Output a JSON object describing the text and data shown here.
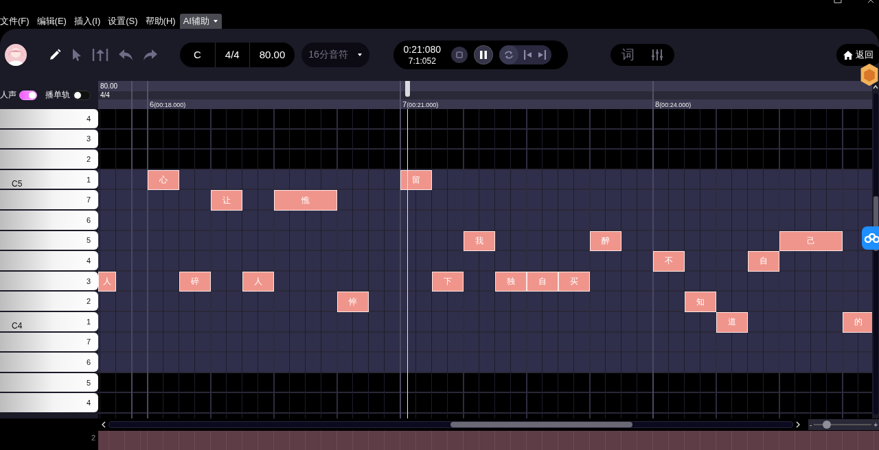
{
  "menu": [
    {
      "label": "文件(F)",
      "selected": false,
      "has_menu": false
    },
    {
      "label": "编辑(E)",
      "selected": false,
      "has_menu": false
    },
    {
      "label": "插入(I)",
      "selected": false,
      "has_menu": false
    },
    {
      "label": "设置(S)",
      "selected": false,
      "has_menu": false
    },
    {
      "label": "帮助(H)",
      "selected": false,
      "has_menu": false
    },
    {
      "label": "AI辅助",
      "selected": true,
      "has_menu": true
    }
  ],
  "toolbar": {
    "tools": [
      {
        "kind": "pencil",
        "selected": true
      },
      {
        "kind": "select",
        "selected": false
      },
      {
        "kind": "split",
        "selected": false
      },
      {
        "kind": "undo",
        "selected": false
      },
      {
        "kind": "redo",
        "selected": false
      }
    ],
    "song": {
      "key": "C",
      "time_signature": "4/4",
      "tempo": "80.00"
    },
    "snap": {
      "value": "16分音符"
    },
    "transport": {
      "time": "0:21:080",
      "position": "7:1:052",
      "playing": true,
      "loop": true
    },
    "panels": [
      {
        "kind": "lyrics",
        "label": "词"
      },
      {
        "kind": "mixer"
      }
    ],
    "home": {
      "label": "返回"
    }
  },
  "track_header": {
    "toggles": [
      {
        "label": "人声",
        "on": true
      },
      {
        "label": "播单轨",
        "on": false
      }
    ]
  },
  "ruler": {
    "tempo": "80.00",
    "time_signature": "4/4",
    "measures": [
      {
        "number": "6",
        "time": "(00:18.000)"
      },
      {
        "number": "7",
        "time": "(00:21.000)"
      },
      {
        "number": "8",
        "time": "(00:24.000)"
      }
    ]
  },
  "piano_keys": [
    {
      "label": "4"
    },
    {
      "label": "3"
    },
    {
      "label": "2"
    },
    {
      "label": "1",
      "octave_label": "C5",
      "slots": [
        {
          "kind": "rest"
        },
        {
          "kind": "rest"
        },
        {
          "kind": "note",
          "lyric": "心"
        },
        {
          "kind": "rest"
        },
        {
          "kind": "rest"
        },
        {
          "kind": "rest"
        },
        {
          "kind": "rest"
        },
        {
          "kind": "rest"
        },
        {
          "kind": "rest"
        },
        {
          "kind": "rest"
        },
        {
          "kind": "note",
          "lyric": "留"
        }
      ]
    },
    {
      "label": "7",
      "slots": [
        {
          "kind": "rest"
        },
        {
          "kind": "rest"
        },
        {
          "kind": "rest"
        },
        {
          "kind": "rest"
        },
        {
          "kind": "note",
          "lyric": "让"
        },
        {
          "kind": "rest"
        },
        {
          "kind": "note",
          "lyric": "憔"
        },
        {
          "kind": "hold"
        }
      ]
    },
    {
      "label": "6"
    },
    {
      "label": "5",
      "slots": [
        {
          "kind": "rest"
        },
        {
          "kind": "rest"
        },
        {
          "kind": "rest"
        },
        {
          "kind": "rest"
        },
        {
          "kind": "rest"
        },
        {
          "kind": "rest"
        },
        {
          "kind": "rest"
        },
        {
          "kind": "rest"
        },
        {
          "kind": "rest"
        },
        {
          "kind": "rest"
        },
        {
          "kind": "rest"
        },
        {
          "kind": "rest"
        },
        {
          "kind": "note",
          "lyric": "我"
        },
        {
          "kind": "rest"
        },
        {
          "kind": "rest"
        },
        {
          "kind": "rest"
        },
        {
          "kind": "note",
          "lyric": "醉"
        },
        {
          "kind": "rest"
        },
        {
          "kind": "rest"
        },
        {
          "kind": "rest"
        },
        {
          "kind": "rest"
        },
        {
          "kind": "rest"
        },
        {
          "kind": "note",
          "lyric": "己"
        },
        {
          "kind": "hold"
        }
      ]
    },
    {
      "label": "4",
      "slots": [
        {
          "kind": "rest"
        },
        {
          "kind": "rest"
        },
        {
          "kind": "rest"
        },
        {
          "kind": "rest"
        },
        {
          "kind": "rest"
        },
        {
          "kind": "rest"
        },
        {
          "kind": "rest"
        },
        {
          "kind": "rest"
        },
        {
          "kind": "rest"
        },
        {
          "kind": "rest"
        },
        {
          "kind": "rest"
        },
        {
          "kind": "rest"
        },
        {
          "kind": "rest"
        },
        {
          "kind": "rest"
        },
        {
          "kind": "rest"
        },
        {
          "kind": "rest"
        },
        {
          "kind": "rest"
        },
        {
          "kind": "rest"
        },
        {
          "kind": "note",
          "lyric": "不"
        },
        {
          "kind": "rest"
        },
        {
          "kind": "rest"
        },
        {
          "kind": "note",
          "lyric": "自"
        }
      ]
    },
    {
      "label": "3",
      "slots": [
        {
          "kind": "note",
          "lyric": "人"
        },
        {
          "kind": "rest"
        },
        {
          "kind": "rest"
        },
        {
          "kind": "note",
          "lyric": "碎"
        },
        {
          "kind": "rest"
        },
        {
          "kind": "note",
          "lyric": "人"
        },
        {
          "kind": "rest"
        },
        {
          "kind": "rest"
        },
        {
          "kind": "rest"
        },
        {
          "kind": "rest"
        },
        {
          "kind": "rest"
        },
        {
          "kind": "note",
          "lyric": "下"
        },
        {
          "kind": "rest"
        },
        {
          "kind": "note",
          "lyric": "独"
        },
        {
          "kind": "note",
          "lyric": "自"
        },
        {
          "kind": "note",
          "lyric": "买"
        }
      ]
    },
    {
      "label": "2",
      "slots": [
        {
          "kind": "rest"
        },
        {
          "kind": "rest"
        },
        {
          "kind": "rest"
        },
        {
          "kind": "rest"
        },
        {
          "kind": "rest"
        },
        {
          "kind": "rest"
        },
        {
          "kind": "rest"
        },
        {
          "kind": "rest"
        },
        {
          "kind": "note",
          "lyric": "悴"
        },
        {
          "kind": "rest"
        },
        {
          "kind": "rest"
        },
        {
          "kind": "rest"
        },
        {
          "kind": "rest"
        },
        {
          "kind": "rest"
        },
        {
          "kind": "rest"
        },
        {
          "kind": "rest"
        },
        {
          "kind": "rest"
        },
        {
          "kind": "rest"
        },
        {
          "kind": "rest"
        },
        {
          "kind": "note",
          "lyric": "知"
        }
      ]
    },
    {
      "label": "1",
      "octave_label": "C4",
      "slots": [
        {
          "kind": "rest"
        },
        {
          "kind": "rest"
        },
        {
          "kind": "rest"
        },
        {
          "kind": "rest"
        },
        {
          "kind": "rest"
        },
        {
          "kind": "rest"
        },
        {
          "kind": "rest"
        },
        {
          "kind": "rest"
        },
        {
          "kind": "rest"
        },
        {
          "kind": "rest"
        },
        {
          "kind": "rest"
        },
        {
          "kind": "rest"
        },
        {
          "kind": "rest"
        },
        {
          "kind": "rest"
        },
        {
          "kind": "rest"
        },
        {
          "kind": "rest"
        },
        {
          "kind": "rest"
        },
        {
          "kind": "rest"
        },
        {
          "kind": "rest"
        },
        {
          "kind": "rest"
        },
        {
          "kind": "note",
          "lyric": "道"
        },
        {
          "kind": "rest"
        },
        {
          "kind": "rest"
        },
        {
          "kind": "rest"
        },
        {
          "kind": "note",
          "lyric": "的"
        }
      ]
    },
    {
      "label": "7"
    },
    {
      "label": "6"
    },
    {
      "label": "5"
    },
    {
      "label": "4"
    }
  ],
  "zoom": {
    "minus": "-",
    "plus": "+",
    "level": 0.18
  },
  "bottom_track": {
    "label": "2"
  }
}
